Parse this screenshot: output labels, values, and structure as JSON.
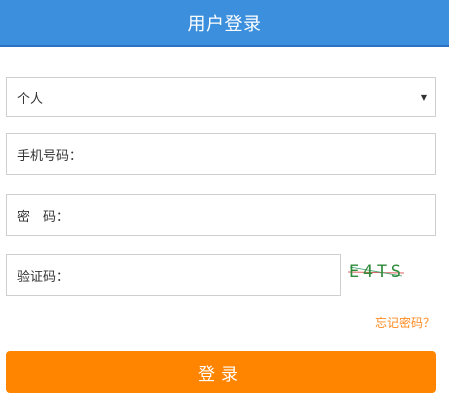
{
  "header": {
    "title": "用户登录"
  },
  "form": {
    "account_type": {
      "selected": "个人"
    },
    "phone": {
      "label": "手机号码："
    },
    "password": {
      "label": "密　码："
    },
    "captcha": {
      "label": "验证码：",
      "image_text": "E4TS"
    },
    "forgot_password": "忘记密码？",
    "submit_label": "登录"
  },
  "colors": {
    "header": "#3c8fdc",
    "accent": "#ff8400",
    "link": "#ff8a1f"
  }
}
